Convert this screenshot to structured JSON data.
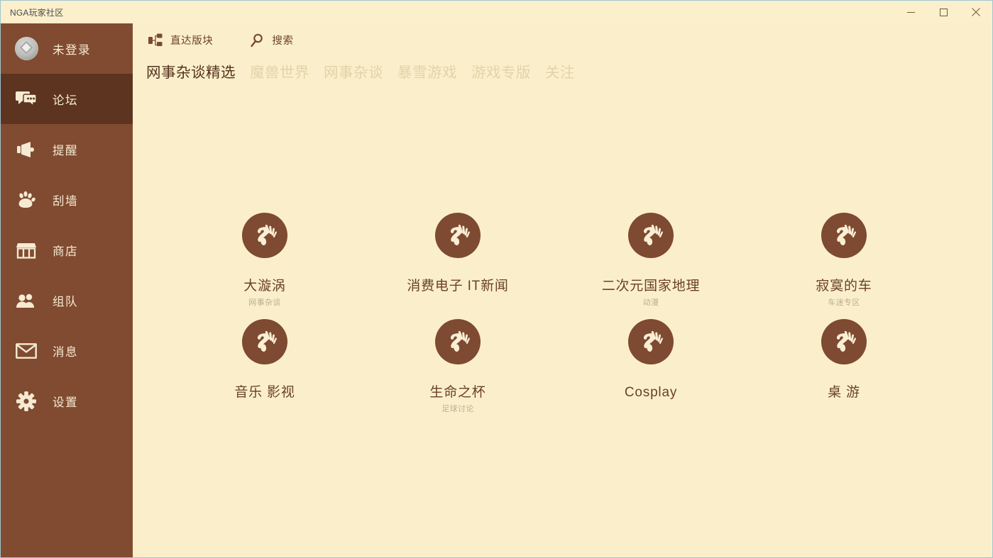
{
  "window": {
    "title": "NGA玩家社区",
    "controls": [
      {
        "name": "minimize-button",
        "glyph": "minimize"
      },
      {
        "name": "maximize-button",
        "glyph": "maximize"
      },
      {
        "name": "close-button",
        "glyph": "close"
      }
    ]
  },
  "colors": {
    "sidebar_bg": "#804B31",
    "sidebar_active_bg": "#5C3420",
    "sidebar_text": "#F6EBD2",
    "content_bg": "#FBEFCB",
    "accent_brown": "#7E4A31",
    "title_text": "#53331F",
    "tab_inactive": "#E2D3A8",
    "forum_name": "#6A4028",
    "forum_sub": "#B9AE91",
    "titlebar_border": "#9FC6D2"
  },
  "sidebar": {
    "items": [
      {
        "label": "未登录",
        "icon": "avatar-icon",
        "active": false
      },
      {
        "label": "论坛",
        "icon": "forum-icon",
        "active": true
      },
      {
        "label": "提醒",
        "icon": "megaphone-icon",
        "active": false
      },
      {
        "label": "刮墙",
        "icon": "paw-icon",
        "active": false
      },
      {
        "label": "商店",
        "icon": "store-icon",
        "active": false
      },
      {
        "label": "组队",
        "icon": "people-icon",
        "active": false
      },
      {
        "label": "消息",
        "icon": "mail-icon",
        "active": false
      },
      {
        "label": "设置",
        "icon": "gear-icon",
        "active": false
      }
    ]
  },
  "toolbar": {
    "buttons": [
      {
        "label": "直达版块",
        "icon": "sitemap-icon"
      },
      {
        "label": "搜索",
        "icon": "search-icon"
      }
    ]
  },
  "tabs": [
    {
      "label": "网事杂谈精选",
      "active": true
    },
    {
      "label": "魔兽世界",
      "active": false
    },
    {
      "label": "网事杂谈",
      "active": false
    },
    {
      "label": "暴雪游戏",
      "active": false
    },
    {
      "label": "游戏专版",
      "active": false
    },
    {
      "label": "关注",
      "active": false
    }
  ],
  "forums": [
    {
      "name": "大漩涡",
      "sub": "网事杂谈",
      "icon": "nga-paw-icon"
    },
    {
      "name": "消费电子 IT新闻",
      "sub": "",
      "icon": "nga-paw-icon"
    },
    {
      "name": "二次元国家地理",
      "sub": "动漫",
      "icon": "nga-paw-icon"
    },
    {
      "name": "寂寞的车",
      "sub": "车迷专区",
      "icon": "nga-paw-icon"
    },
    {
      "name": "音乐 影视",
      "sub": "",
      "icon": "nga-paw-icon"
    },
    {
      "name": "生命之杯",
      "sub": "足球讨论",
      "icon": "nga-paw-icon"
    },
    {
      "name": "Cosplay",
      "sub": "",
      "icon": "nga-paw-icon"
    },
    {
      "name": "桌 游",
      "sub": "",
      "icon": "nga-paw-icon"
    }
  ]
}
